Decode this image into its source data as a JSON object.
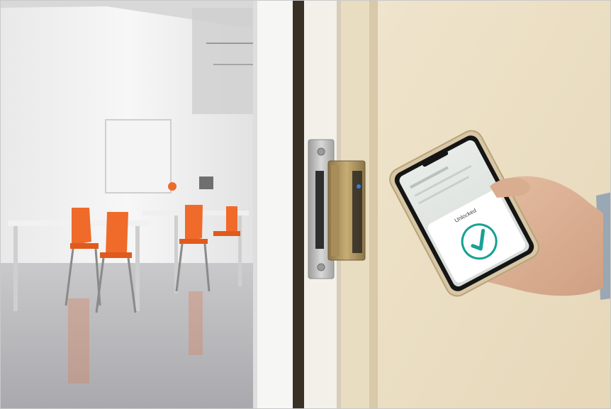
{
  "scene": {
    "kind": "photo",
    "colors": {
      "wall": "#ece0c6",
      "room_floor": "#bdbdbf",
      "chair_orange": "#f06a2a",
      "strike_brass": "#b59a63",
      "status_led": "#3a7be0",
      "check_teal": "#17a195"
    }
  },
  "phone": {
    "dialog_title": "Unlocked"
  },
  "icons": {
    "led": "status-led-icon",
    "check": "checkmark-icon"
  }
}
